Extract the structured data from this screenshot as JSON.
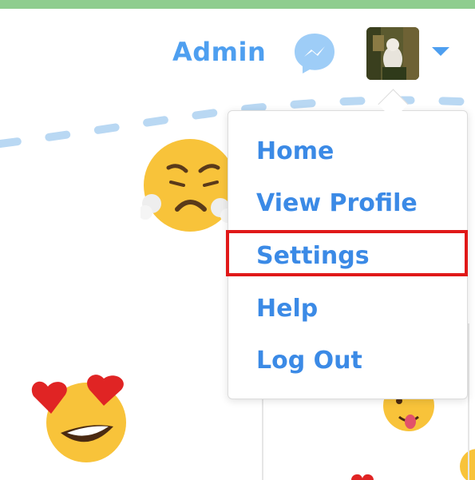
{
  "header": {
    "admin_label": "Admin",
    "messenger_icon": "messenger-icon",
    "avatar": "user-avatar",
    "dropdown_caret_icon": "caret-down-icon"
  },
  "dropdown": {
    "items": [
      {
        "label": "Home"
      },
      {
        "label": "View Profile"
      },
      {
        "label": "Settings",
        "highlighted": true
      },
      {
        "label": "Help"
      },
      {
        "label": "Log Out"
      }
    ]
  },
  "background_emojis": [
    "face-with-steam-emoji",
    "heart-eyes-emoji",
    "tongue-wink-emoji"
  ],
  "colors": {
    "accent": "#4e9ff0",
    "menu_text": "#3b8ae6",
    "top_strip": "#8fcd8f",
    "highlight": "#e01818"
  }
}
